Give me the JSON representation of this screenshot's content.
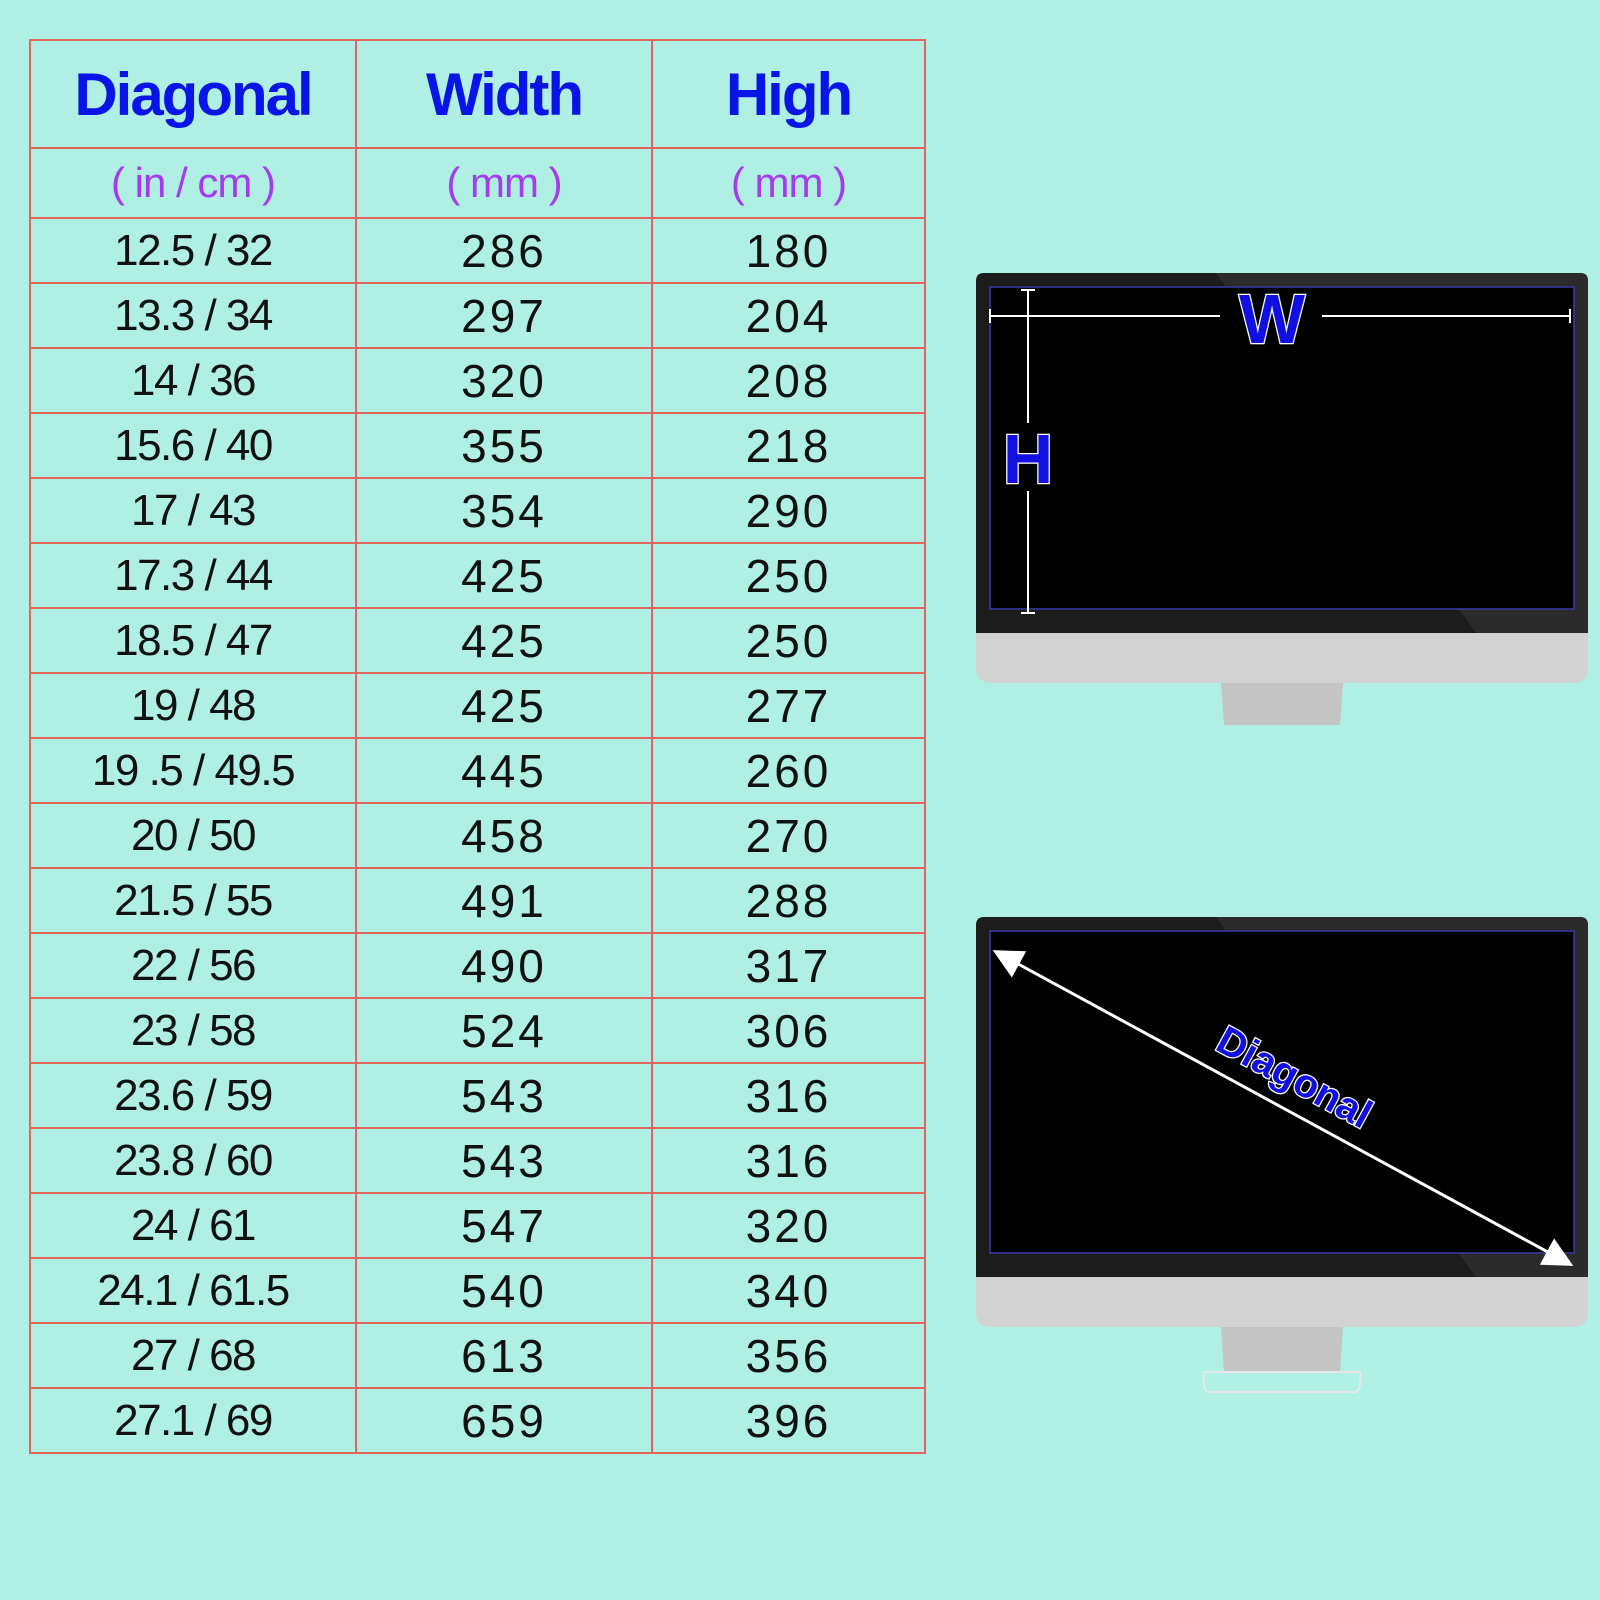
{
  "table": {
    "headers": [
      "Diagonal",
      "Width",
      "High"
    ],
    "units": [
      "( in / cm )",
      "( mm )",
      "( mm )"
    ],
    "rows": [
      [
        "12.5 / 32",
        "286",
        "180"
      ],
      [
        "13.3 / 34",
        "297",
        "204"
      ],
      [
        "14 / 36",
        "320",
        "208"
      ],
      [
        "15.6 / 40",
        "355",
        "218"
      ],
      [
        "17 / 43",
        "354",
        "290"
      ],
      [
        "17.3 / 44",
        "425",
        "250"
      ],
      [
        "18.5 / 47",
        "425",
        "250"
      ],
      [
        "19 / 48",
        "425",
        "277"
      ],
      [
        "19 .5 / 49.5",
        "445",
        "260"
      ],
      [
        "20 / 50",
        "458",
        "270"
      ],
      [
        "21.5 / 55",
        "491",
        "288"
      ],
      [
        "22 / 56",
        "490",
        "317"
      ],
      [
        "23 / 58",
        "524",
        "306"
      ],
      [
        "23.6 / 59",
        "543",
        "316"
      ],
      [
        "23.8 / 60",
        "543",
        "316"
      ],
      [
        "24 / 61",
        "547",
        "320"
      ],
      [
        "24.1 / 61.5",
        "540",
        "340"
      ],
      [
        "27 / 68",
        "613",
        "356"
      ],
      [
        "27.1 / 69",
        "659",
        "396"
      ]
    ]
  },
  "diagram_wh": {
    "width_label": "W",
    "height_label": "H"
  },
  "diagram_diagonal": {
    "label": "Diagonal"
  },
  "colors": {
    "background": "#b0efe4",
    "grid": "#e4655a",
    "header_text": "#0a14e6",
    "unit_text": "#a53bf0",
    "screen": "#000000",
    "bezel": "#1c1c1c",
    "chin": "#d2d2d2"
  }
}
